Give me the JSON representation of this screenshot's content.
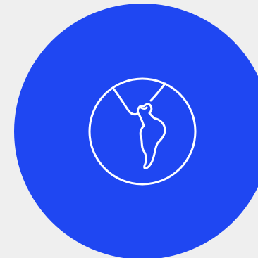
{
  "app_icon": {
    "icon": "globe-americas-icon",
    "background_color": "#1f47f2",
    "icon_color": "#ffffff",
    "page_background_color": "#efefef"
  }
}
